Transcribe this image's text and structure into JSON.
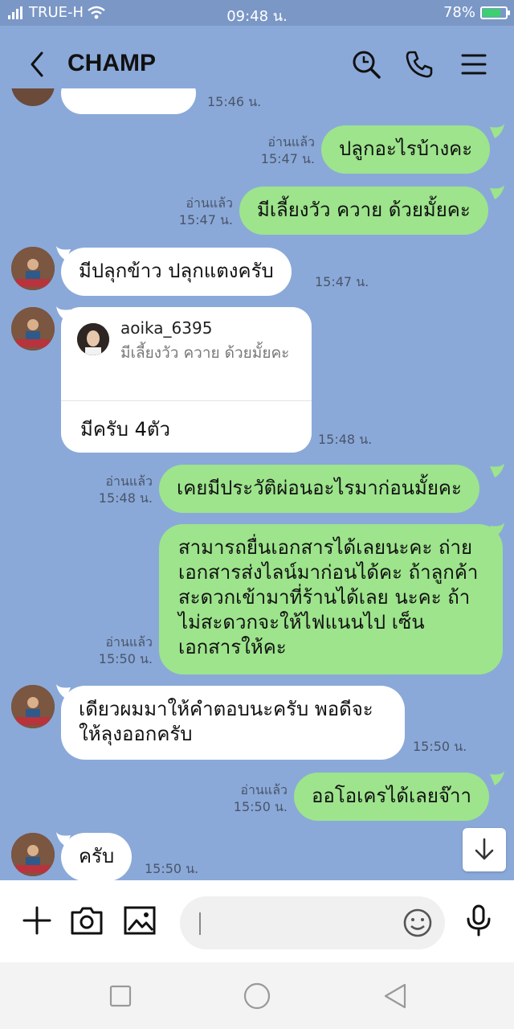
{
  "status_bar": {
    "carrier": "TRUE-H",
    "time": "09:48 น.",
    "battery": "78%",
    "battery_level": 0.78,
    "icons": [
      "signal-icon",
      "wifi-icon",
      "battery-charging-icon"
    ]
  },
  "header": {
    "title": "CHAMP",
    "icons": [
      "back-arrow-icon",
      "search-icon",
      "phone-icon",
      "menu-icon"
    ]
  },
  "messages": [
    {
      "dir": "out",
      "text": "ปลูกอะไรบ้างคะ",
      "read": "อ่านแล้ว",
      "time": "15:47 น."
    },
    {
      "dir": "out",
      "text": "มีเลี้ยงวัว ควาย ด้วยมั้ยคะ",
      "read": "อ่านแล้ว",
      "time": "15:47 น."
    },
    {
      "dir": "in",
      "text": "มีปลุกข้าว ปลุกแตงครับ",
      "time": "15:47 น."
    },
    {
      "dir": "in",
      "reply_to_name": "aoika_6395",
      "reply_to_text": "มีเลี้ยงวัว ควาย ด้วยมั้ยคะ",
      "text": "มีครับ 4ตัว",
      "time": "15:48 น."
    },
    {
      "dir": "out",
      "text": "เคยมีประวัติผ่อนอะไรมาก่อนมั้ยคะ",
      "read": "อ่านแล้ว",
      "time": "15:48 น."
    },
    {
      "dir": "out",
      "text": "สามารถยื่นเอกสารได้เลยนะคะ ถ่ายเอกสารส่งไลน์มาก่อนได้คะ ถ้าลูกค้าสะดวกเข้ามาที่ร้านได้เลย นะคะ ถ้าไม่สะดวกจะให้ไฟแนนไป เซ็นเอกสารให้คะ",
      "read": "อ่านแล้ว",
      "time": "15:50 น."
    },
    {
      "dir": "in",
      "text": "เดียวผมมาให้คำตอบนะครับ พอดีจะให้ลุงออกครับ",
      "time": "15:50 น."
    },
    {
      "dir": "out",
      "text": "ออโอเครได้เลยจ๊าา",
      "read": "อ่านแล้ว",
      "time": "15:50 น."
    },
    {
      "dir": "in",
      "text": "ครับ",
      "time": "15:50 น."
    }
  ],
  "partial_top_time": "15:46 น.",
  "input": {
    "placeholder": "",
    "icons": [
      "plus-icon",
      "camera-icon",
      "image-icon",
      "emoji-icon",
      "microphone-icon"
    ]
  },
  "colors": {
    "chat_bg": "#8aa9d9",
    "outgoing_bubble": "#9de48c",
    "incoming_bubble": "#ffffff"
  }
}
